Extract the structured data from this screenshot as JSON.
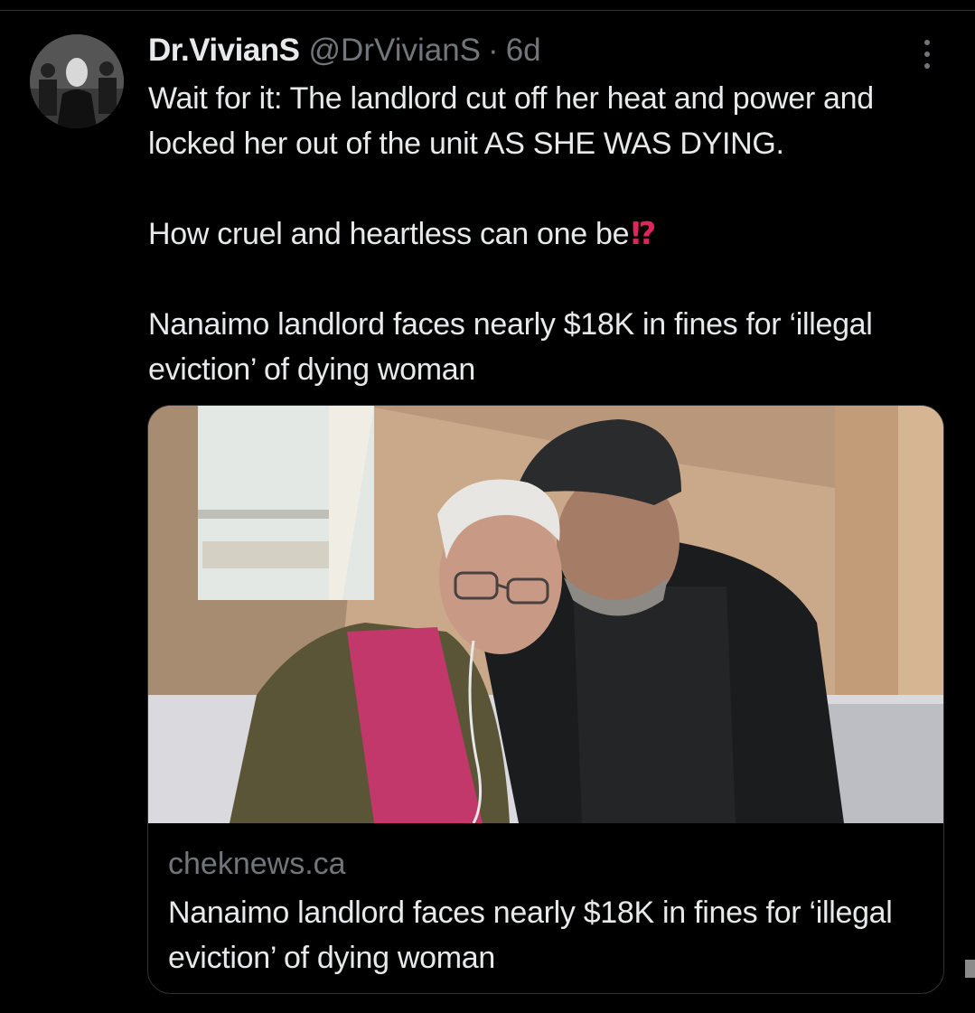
{
  "tweet": {
    "display_name": "Dr.VivianS",
    "handle": "@DrVivianS",
    "separator": "·",
    "time": "6d",
    "text_line1": "Wait for it: The landlord cut off her heat and power and locked her out of the unit AS SHE WAS DYING.",
    "text_line2": "How cruel and heartless can one be",
    "text_emoji": "⁉",
    "text_line3": "Nanaimo landlord faces nearly $18K in fines for ‘illegal eviction’ of dying woman",
    "avatar_icon": "user-avatar-icon",
    "more_icon": "more-options-icon"
  },
  "card": {
    "domain": "cheknews.ca",
    "title": "Nanaimo landlord faces nearly $18K in fines for ‘illegal eviction’ of dying woman",
    "image_icon": "news-photo"
  },
  "colors": {
    "background": "#000000",
    "text_primary": "#e7e9ea",
    "text_secondary": "#71767b",
    "border": "#2f3336",
    "emoji_red": "#e0245e"
  }
}
